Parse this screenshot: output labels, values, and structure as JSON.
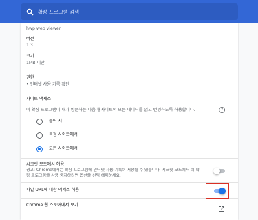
{
  "search": {
    "placeholder": "확장 프로그램 검색"
  },
  "version_section_top": {
    "value": "hwp web viewer"
  },
  "version": {
    "label": "버전",
    "value": "1.3"
  },
  "size": {
    "label": "크기",
    "value": "1MB 미만"
  },
  "permissions": {
    "label": "권한",
    "items": [
      "인터넷 사용 기록 확인"
    ]
  },
  "site_access": {
    "title": "사이트 액세스",
    "description": "이 확장 프로그램이 내가 방문하는 다음 웹사이트의 모든 데이터를 읽고 변경하도록 허용합니다.",
    "options": [
      {
        "label": "클릭 시",
        "checked": false
      },
      {
        "label": "특정 사이트에서",
        "checked": false
      },
      {
        "label": "모든 사이트에서",
        "checked": true
      }
    ]
  },
  "incognito": {
    "title": "시크릿 모드에서 허용",
    "warning_line1": "경고: Chrome에서는 확장 프로그램에 인터넷 사용 기록이 저장될 수 있습니다. 시크릿 모드에서 이 확",
    "warning_line2": "장 프로그램을 사용 중지하려면 옵션을 선택 해제하세요.",
    "enabled": false
  },
  "file_urls": {
    "label": "파일 URL에 대한 액세스 허용",
    "enabled": true
  },
  "store": {
    "label": "Chrome 웹 스토어에서 보기"
  },
  "icons": {
    "search": "search-icon",
    "help": "help-circle-icon",
    "external": "open-in-new-icon"
  },
  "colors": {
    "header": "#3367d6",
    "accent": "#1a73e8",
    "highlight_border": "#d93025"
  }
}
